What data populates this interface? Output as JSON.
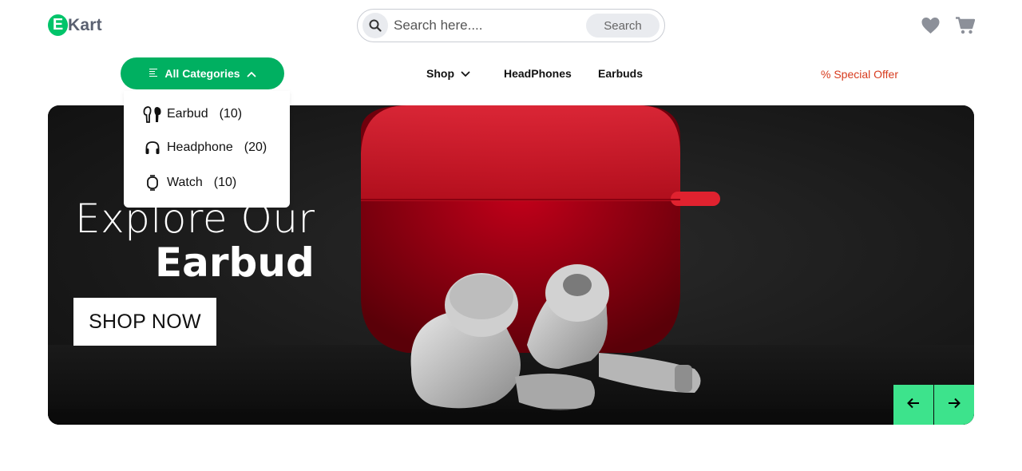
{
  "brand": {
    "badge_letter": "E",
    "name": "Kart",
    "color": "#00c46a"
  },
  "search": {
    "placeholder": "Search here....",
    "button_label": "Search"
  },
  "header_icons": [
    "heart-icon",
    "cart-icon"
  ],
  "nav": {
    "categories_label": "All Categories",
    "items": [
      {
        "label": "Shop",
        "has_dropdown": true
      },
      {
        "label": "HeadPhones"
      },
      {
        "label": "Earbuds"
      }
    ],
    "special_offer": "% Special Offer"
  },
  "categories_dropdown": [
    {
      "icon": "earbud-icon",
      "label": "Earbud",
      "count": "(10)"
    },
    {
      "icon": "headphone-icon",
      "label": "Headphone",
      "count": "(20)"
    },
    {
      "icon": "watch-icon",
      "label": "Watch",
      "count": "(10)"
    }
  ],
  "hero": {
    "title_line1": "Explore Our",
    "title_line2": "Earbud",
    "cta_label": "SHOP NOW",
    "controls": [
      "arrow-left-icon",
      "arrow-right-icon"
    ]
  },
  "colors": {
    "accent": "#00b061",
    "arrow_bg": "#3de38c",
    "special_offer": "#d73a1d"
  }
}
